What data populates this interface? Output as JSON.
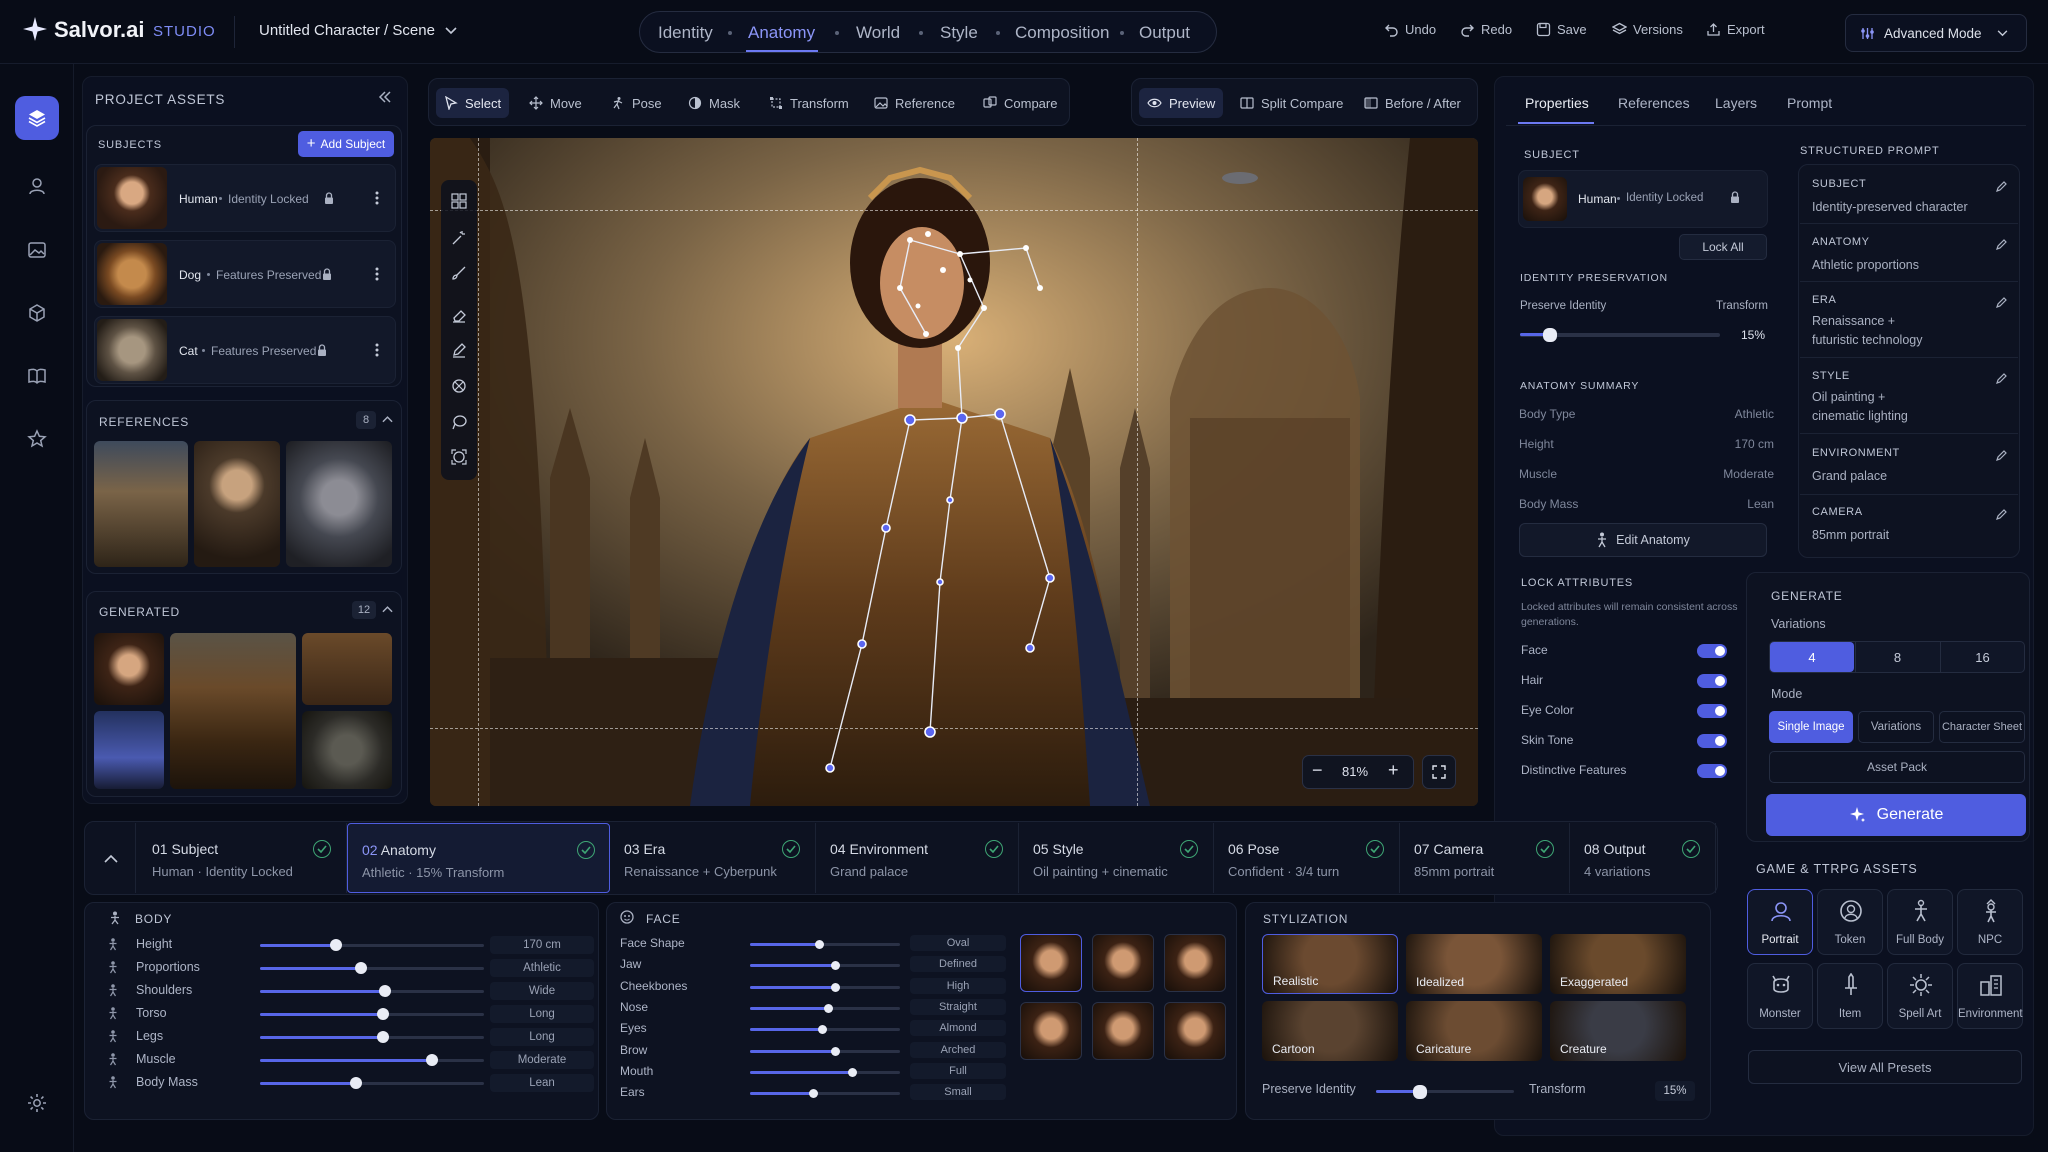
{
  "app": {
    "brand": "Salvor.ai",
    "studio": "STUDIO",
    "project_title": "Untitled Character / Scene"
  },
  "nav": {
    "items": [
      "Identity",
      "Anatomy",
      "World",
      "Style",
      "Composition",
      "Output"
    ],
    "active": "Anatomy"
  },
  "top_actions": {
    "undo": "Undo",
    "redo": "Redo",
    "save": "Save",
    "versions": "Versions",
    "export": "Export",
    "mode": "Advanced Mode"
  },
  "project_assets": {
    "title": "PROJECT ASSETS",
    "subjects_label": "SUBJECTS",
    "add_subject": "Add Subject",
    "subjects": [
      {
        "name": "Human",
        "status": "Identity Locked"
      },
      {
        "name": "Dog",
        "status": "Features Preserved"
      },
      {
        "name": "Cat",
        "status": "Features Preserved"
      }
    ],
    "references_label": "REFERENCES",
    "references_count": "8",
    "generated_label": "GENERATED",
    "generated_count": "12"
  },
  "canvas_toolbar": {
    "tools": [
      "Select",
      "Move",
      "Pose",
      "Mask",
      "Transform",
      "Reference",
      "Compare"
    ],
    "views": [
      "Preview",
      "Split Compare",
      "Before / After"
    ]
  },
  "canvas": {
    "zoom": "81%",
    "zoom_minus": "−",
    "zoom_plus": "+"
  },
  "properties": {
    "tabs": [
      "Properties",
      "References",
      "Layers",
      "Prompt"
    ],
    "subject_label": "SUBJECT",
    "subject_name": "Human",
    "subject_status": "Identity Locked",
    "lock_all": "Lock All",
    "identity_label": "IDENTITY PRESERVATION",
    "preserve_identity": "Preserve Identity",
    "transform": "Transform",
    "transform_value": "15%",
    "transform_fraction": 0.15,
    "anatomy_label": "ANATOMY SUMMARY",
    "anatomy": [
      {
        "k": "Body Type",
        "v": "Athletic"
      },
      {
        "k": "Height",
        "v": "170 cm"
      },
      {
        "k": "Muscle",
        "v": "Moderate"
      },
      {
        "k": "Body Mass",
        "v": "Lean"
      }
    ],
    "edit_anatomy": "Edit Anatomy",
    "lock_label": "LOCK ATTRIBUTES",
    "lock_note": "Locked attributes will remain consistent across generations.",
    "locks": [
      "Face",
      "Hair",
      "Eye Color",
      "Skin Tone",
      "Distinctive Features"
    ]
  },
  "structured_prompt": {
    "title": "STRUCTURED PROMPT",
    "items": [
      {
        "k": "SUBJECT",
        "v": [
          "Identity-preserved character"
        ]
      },
      {
        "k": "ANATOMY",
        "v": [
          "Athletic proportions"
        ]
      },
      {
        "k": "ERA",
        "v": [
          "Renaissance +",
          "futuristic technology"
        ]
      },
      {
        "k": "STYLE",
        "v": [
          "Oil painting +",
          "cinematic lighting"
        ]
      },
      {
        "k": "ENVIRONMENT",
        "v": [
          "Grand palace"
        ]
      },
      {
        "k": "CAMERA",
        "v": [
          "85mm portrait"
        ]
      }
    ]
  },
  "generate": {
    "title": "GENERATE",
    "variations_label": "Variations",
    "variations": [
      "4",
      "8",
      "16"
    ],
    "variations_selected": "4",
    "mode_label": "Mode",
    "modes": [
      "Single Image",
      "Variations",
      "Character Sheet"
    ],
    "mode_selected": "Single Image",
    "asset_pack": "Asset Pack",
    "button": "Generate"
  },
  "game_assets": {
    "title": "GAME & TTRPG ASSETS",
    "items": [
      "Portrait",
      "Token",
      "Full Body",
      "NPC",
      "Monster",
      "Item",
      "Spell Art",
      "Environment"
    ],
    "view_all": "View All Presets"
  },
  "steps": [
    {
      "n": "01",
      "t": "Subject",
      "s": "Human · Identity Locked"
    },
    {
      "n": "02",
      "t": "Anatomy",
      "s": "Athletic · 15% Transform"
    },
    {
      "n": "03",
      "t": "Era",
      "s": "Renaissance + Cyberpunk"
    },
    {
      "n": "04",
      "t": "Environment",
      "s": "Grand palace"
    },
    {
      "n": "05",
      "t": "Style",
      "s": "Oil painting + cinematic"
    },
    {
      "n": "06",
      "t": "Pose",
      "s": "Confident · 3/4 turn"
    },
    {
      "n": "07",
      "t": "Camera",
      "s": "85mm portrait"
    },
    {
      "n": "08",
      "t": "Output",
      "s": "4 variations"
    }
  ],
  "body": {
    "title": "BODY",
    "rows": [
      {
        "k": "Height",
        "v": "170 cm",
        "level": 0.34
      },
      {
        "k": "Proportions",
        "v": "Athletic",
        "level": 0.45
      },
      {
        "k": "Shoulders",
        "v": "Wide",
        "level": 0.56
      },
      {
        "k": "Torso",
        "v": "Long",
        "level": 0.55
      },
      {
        "k": "Legs",
        "v": "Long",
        "level": 0.55
      },
      {
        "k": "Muscle",
        "v": "Moderate",
        "level": 0.77
      },
      {
        "k": "Body Mass",
        "v": "Lean",
        "level": 0.43
      }
    ]
  },
  "face": {
    "title": "FACE",
    "rows": [
      {
        "k": "Face Shape",
        "v": "Oval",
        "level": 0.46
      },
      {
        "k": "Jaw",
        "v": "Defined",
        "level": 0.57
      },
      {
        "k": "Cheekbones",
        "v": "High",
        "level": 0.57
      },
      {
        "k": "Nose",
        "v": "Straight",
        "level": 0.52
      },
      {
        "k": "Eyes",
        "v": "Almond",
        "level": 0.48
      },
      {
        "k": "Brow",
        "v": "Arched",
        "level": 0.57
      },
      {
        "k": "Mouth",
        "v": "Full",
        "level": 0.68
      },
      {
        "k": "Ears",
        "v": "Small",
        "level": 0.42
      }
    ]
  },
  "stylization": {
    "title": "STYLIZATION",
    "items": [
      "Realistic",
      "Idealized",
      "Exaggerated",
      "Cartoon",
      "Caricature",
      "Creature"
    ],
    "selected": "Realistic",
    "preserve_identity": "Preserve Identity",
    "transform": "Transform",
    "value": "15%",
    "level": 0.32
  },
  "colors": {
    "accent": "#4f5de0",
    "bg": "#080c17",
    "panel": "#0e1322",
    "check": "#3ea574"
  }
}
